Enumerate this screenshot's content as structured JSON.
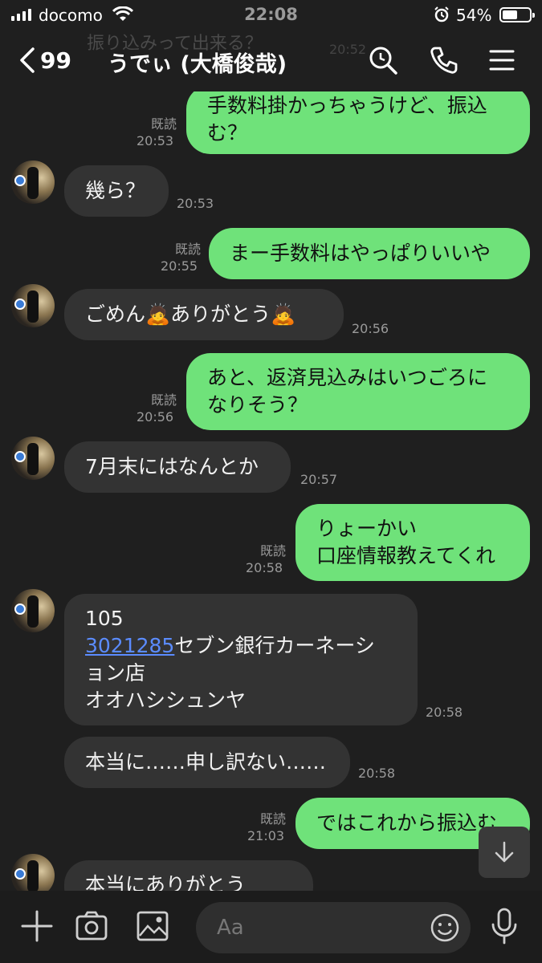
{
  "status_bar": {
    "carrier": "docomo",
    "time": "22:08",
    "battery": "54%",
    "battery_level": 0.54
  },
  "header": {
    "pinned_preview": "振り込みって出来る？",
    "pinned_time": "20:52",
    "back_count": "99",
    "title": "うでぃ (大橋俊哉)",
    "icons": [
      "search-icon",
      "phone-icon",
      "menu-icon"
    ]
  },
  "messages": [
    {
      "side": "out",
      "lines": [
        "手数料掛かっちゃうけど、振込",
        "む？"
      ],
      "read": "既読",
      "time": "20:53"
    },
    {
      "side": "in",
      "lines": [
        "幾ら？"
      ],
      "time": "20:53"
    },
    {
      "side": "out",
      "lines": [
        "まー手数料はやっぱりいいや"
      ],
      "read": "既読",
      "time": "20:55"
    },
    {
      "side": "in",
      "lines": [
        "ごめん🙇ありがとう🙇"
      ],
      "time": "20:56"
    },
    {
      "side": "out",
      "lines": [
        "あと、返済見込みはいつごろに",
        "なりそう？"
      ],
      "read": "既読",
      "time": "20:56"
    },
    {
      "side": "in",
      "lines": [
        "7月末にはなんとか"
      ],
      "time": "20:57"
    },
    {
      "side": "out",
      "lines": [
        "りょーかい",
        "口座情報教えてくれ"
      ],
      "read": "既読",
      "time": "20:58"
    },
    {
      "side": "in",
      "lines": [
        "105",
        "セブン銀行カーネーシ",
        "ョン店",
        "オオハシシュンヤ"
      ],
      "link": "3021285",
      "time": "20:58"
    },
    {
      "side": "in",
      "lines": [
        "本当に……申し訳ない……"
      ],
      "time": "20:58"
    },
    {
      "side": "out",
      "lines": [
        "ではこれから振込む"
      ],
      "read": "既読",
      "time": "21:03"
    },
    {
      "side": "in",
      "lines": [
        "本当にありがとう"
      ]
    }
  ],
  "input": {
    "placeholder": "Aa",
    "icons": [
      "plus-icon",
      "camera-icon",
      "image-icon",
      "emoji-icon",
      "microphone-icon"
    ]
  },
  "colors": {
    "background": "#1f1f1f",
    "outgoing_bubble": "#6fe27a",
    "incoming_bubble": "#333333",
    "link": "#5b8cff"
  }
}
